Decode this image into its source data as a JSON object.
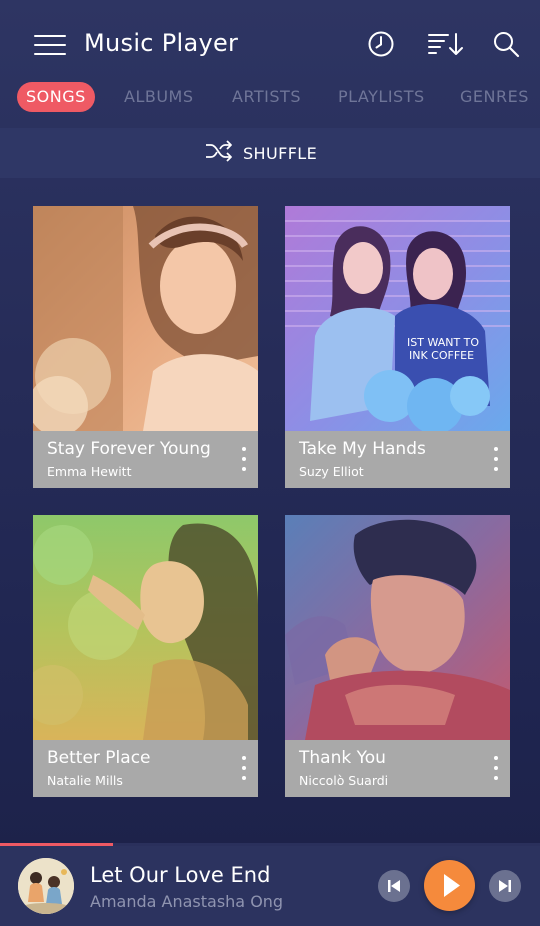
{
  "app": {
    "title": "Music Player"
  },
  "header_icons": [
    "menu-icon",
    "clock-icon",
    "sort-icon",
    "search-icon"
  ],
  "tabs": [
    {
      "label": "SONGS",
      "active": true
    },
    {
      "label": "ALBUMS",
      "active": false
    },
    {
      "label": "ARTISTS",
      "active": false
    },
    {
      "label": "PLAYLISTS",
      "active": false
    },
    {
      "label": "GENRES",
      "active": false
    }
  ],
  "shuffle": {
    "label": "SHUFFLE"
  },
  "songs": [
    {
      "title": "Stay Forever Young",
      "artist": "Emma Hewitt"
    },
    {
      "title": "Take My Hands",
      "artist": "Suzy Elliot"
    },
    {
      "title": "Better Place",
      "artist": "Natalie Mills"
    },
    {
      "title": "Thank You",
      "artist": "Niccolò Suardi"
    }
  ],
  "now_playing": {
    "title": "Let Our Love End",
    "artist": "Amanda Anastasha Ong",
    "progress": 0.21
  },
  "colors": {
    "accent": "#ef5a64",
    "play_orange": "#f58a3c",
    "background": "#262c58",
    "card_footer": "#a9a9a9"
  }
}
